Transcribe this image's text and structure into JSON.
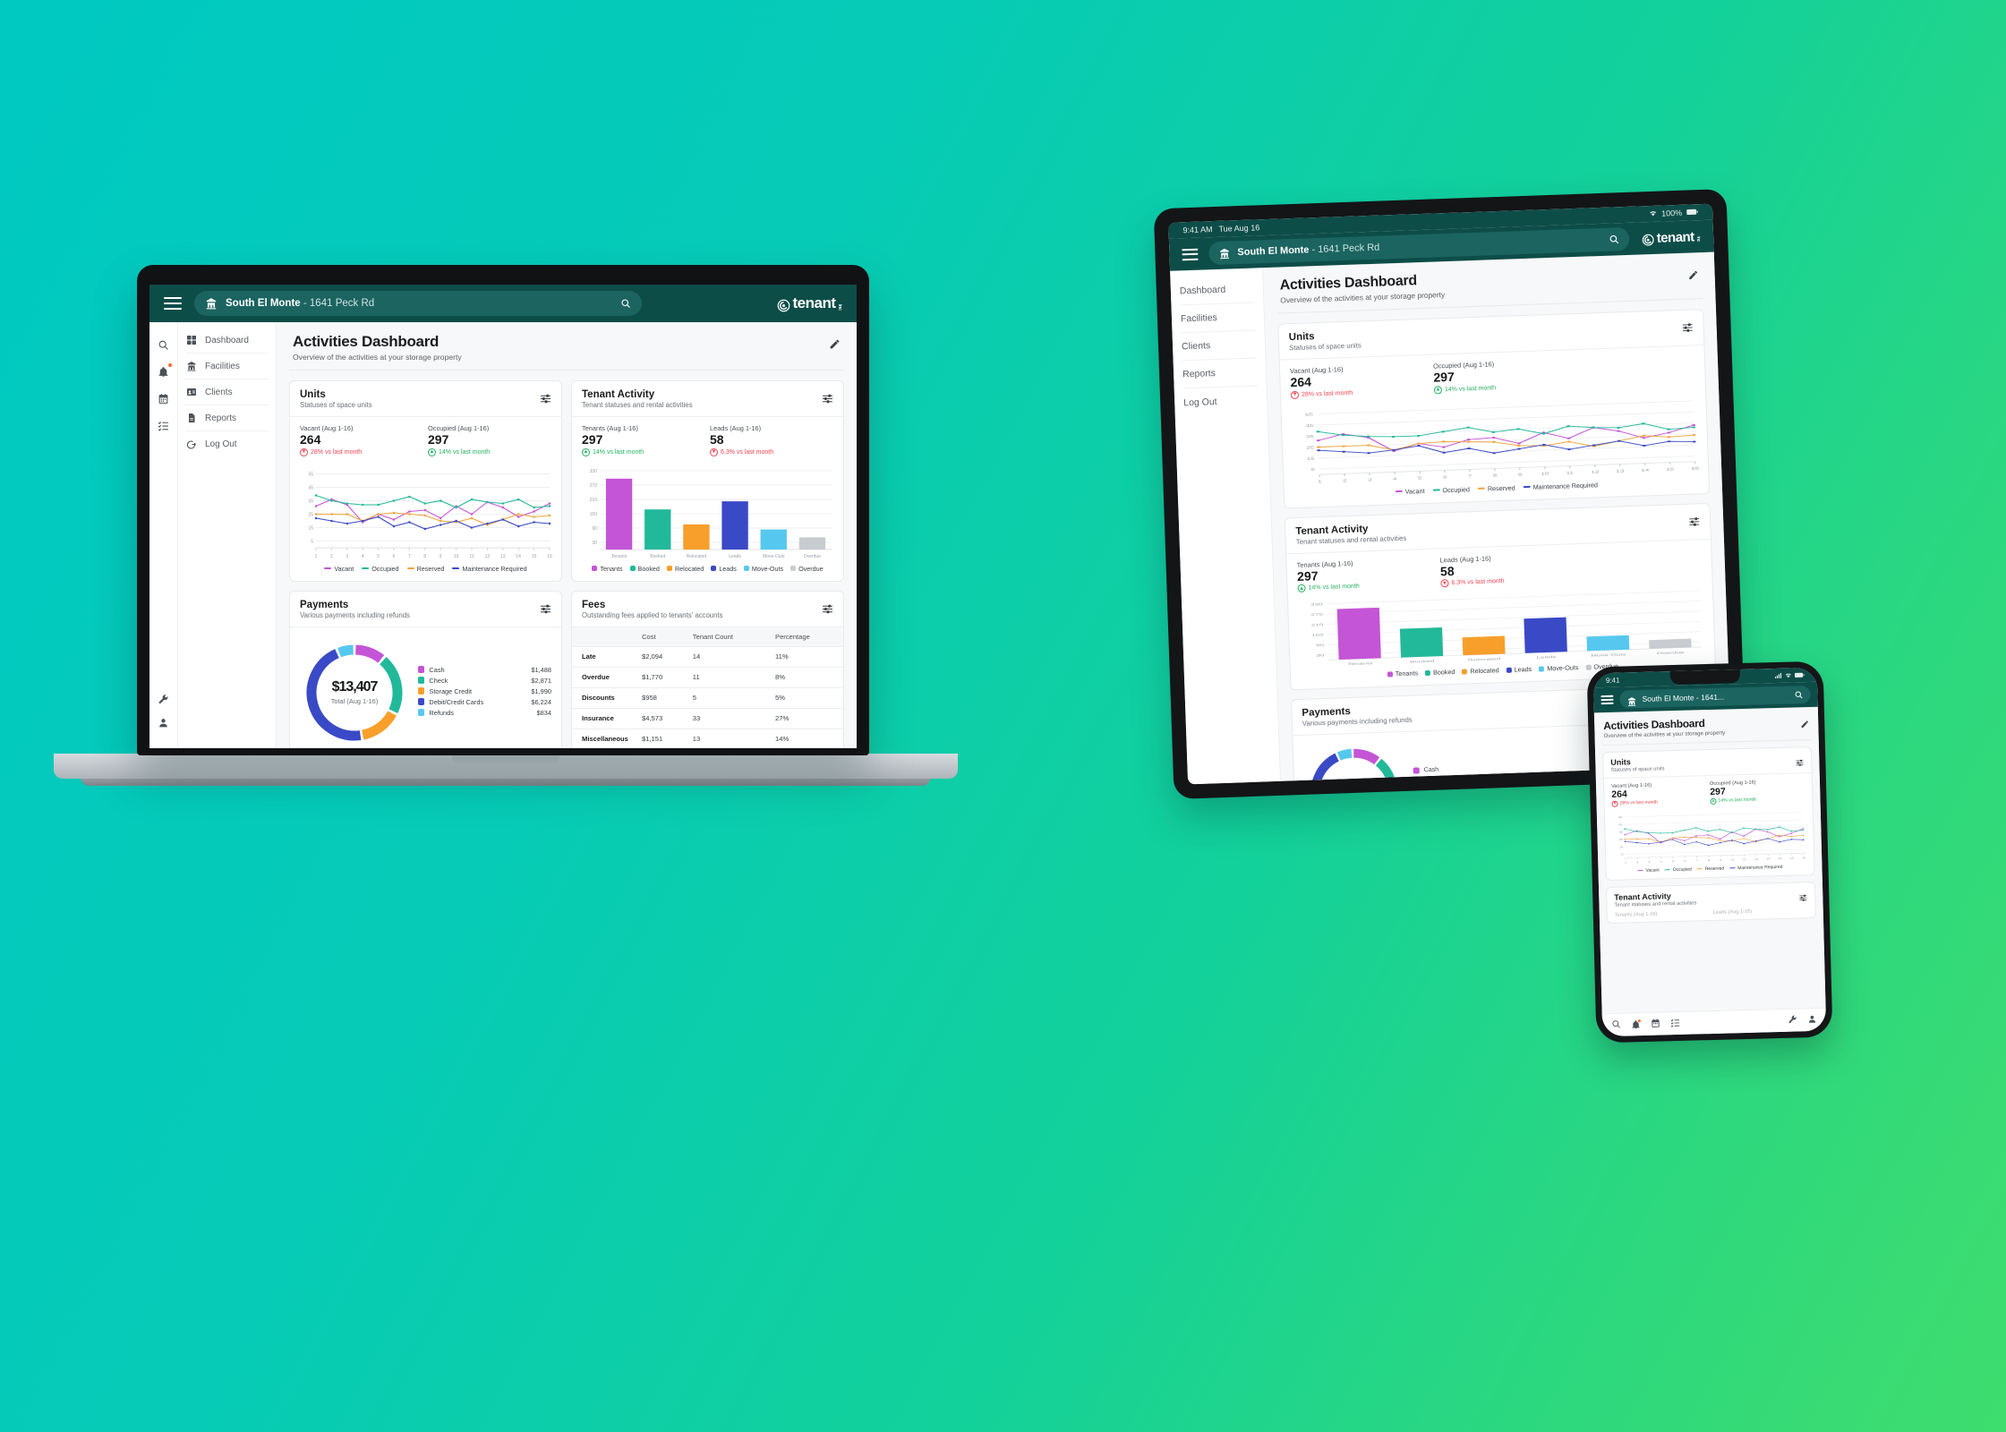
{
  "brand": {
    "logo_text": "tenant",
    "logo_suffix": "inc",
    "accent_teal": "#0d4d48",
    "pill_teal": "#1b6460",
    "bg_gradient_from": "#00c9c2",
    "bg_gradient_to": "#3fdd6e"
  },
  "topbar": {
    "property_name": "South El Monte",
    "property_address": "- 1641 Peck Rd",
    "property_full": "South El Monte - 1641 Peck Rd",
    "property_truncated": "South El Monte - 1641...",
    "menu_icon": "hamburger-icon",
    "search_icon": "search-icon",
    "house_icon": "storage-facility-icon"
  },
  "page": {
    "title": "Activities Dashboard",
    "subtitle": "Overview of the activities at your storage property",
    "edit_icon": "pencil-icon"
  },
  "sidebar": {
    "items": [
      {
        "label": "Dashboard",
        "icon": "grid-icon"
      },
      {
        "label": "Facilities",
        "icon": "storage-facility-icon"
      },
      {
        "label": "Clients",
        "icon": "id-card-icon"
      },
      {
        "label": "Reports",
        "icon": "document-icon"
      },
      {
        "label": "Log Out",
        "icon": "logout-icon"
      }
    ]
  },
  "icon_rail": {
    "top": [
      "search-icon",
      "notification-bell-icon",
      "calendar-icon",
      "checklist-icon"
    ],
    "bottom": [
      "wrench-icon",
      "user-icon"
    ]
  },
  "phone_tabbar": {
    "items": [
      "search-icon",
      "notification-bell-icon",
      "calendar-icon",
      "checklist-icon",
      "wrench-icon",
      "user-icon"
    ]
  },
  "tablet_status": {
    "time": "9:41 AM",
    "date": "Tue Aug 16",
    "battery": "100%",
    "wifi_icon": "wifi-icon",
    "battery_icon": "battery-icon"
  },
  "phone_status": {
    "time": "9:41",
    "signal_icon": "cellular-icon",
    "wifi_icon": "wifi-icon",
    "battery_icon": "battery-icon"
  },
  "cards": {
    "units": {
      "title": "Units",
      "subtitle": "Statuses of space units",
      "settings_icon": "sliders-icon",
      "kpis": [
        {
          "label": "Vacant (Aug 1-16)",
          "value": "264",
          "delta": "28% vs last month",
          "direction": "down"
        },
        {
          "label": "Occupied (Aug 1-16)",
          "value": "297",
          "delta": "14% vs last month",
          "direction": "up"
        }
      ]
    },
    "tenant_activity": {
      "title": "Tenant Activity",
      "subtitle": "Tenant statuses and rental activities",
      "settings_icon": "sliders-icon",
      "kpis": [
        {
          "label": "Tenants (Aug 1-16)",
          "value": "297",
          "delta": "14% vs last month",
          "direction": "up"
        },
        {
          "label": "Leads (Aug 1-16)",
          "value": "58",
          "delta": "6.3% vs last month",
          "direction": "down"
        }
      ]
    },
    "payments": {
      "title": "Payments",
      "subtitle": "Various payments including refunds",
      "settings_icon": "sliders-icon",
      "total": "$13,407",
      "total_label": "Total (Aug 1-16)"
    },
    "fees": {
      "title": "Fees",
      "subtitle": "Outstanding fees applied to tenants' accounts",
      "settings_icon": "sliders-icon"
    }
  },
  "chart_data": [
    {
      "type": "line",
      "id": "units-line-chart",
      "title": "Units",
      "xlabel": "",
      "ylabel": "",
      "x": [
        1,
        2,
        3,
        4,
        5,
        6,
        7,
        8,
        9,
        10,
        11,
        12,
        13,
        14,
        15,
        16
      ],
      "ytick_labels": [
        "55",
        "45",
        "35",
        "25",
        "15",
        "5"
      ],
      "ylim": [
        0,
        60
      ],
      "grid": true,
      "legend_position": "bottom",
      "series": [
        {
          "name": "Vacant",
          "color": "#c455d6",
          "values": [
            31,
            36,
            32,
            19,
            25,
            21,
            27,
            28,
            22,
            31,
            25,
            34,
            30,
            23,
            27,
            33
          ]
        },
        {
          "name": "Occupied",
          "color": "#22b99a",
          "values": [
            39,
            35,
            33,
            32,
            32,
            35,
            38,
            33,
            35,
            30,
            36,
            34,
            33,
            36,
            30,
            31
          ]
        },
        {
          "name": "Reserved",
          "color": "#f0a53a",
          "values": [
            25,
            25,
            25,
            20,
            25,
            26,
            25,
            24,
            20,
            19,
            22,
            17,
            21,
            25,
            23,
            24
          ]
        },
        {
          "name": "Maintenance Required",
          "color": "#3a49c6",
          "values": [
            22,
            20,
            18,
            20,
            23,
            16,
            19,
            14,
            17,
            20,
            15,
            18,
            21,
            16,
            19,
            18
          ]
        }
      ]
    },
    {
      "type": "bar",
      "id": "tenant-activity-bar-chart",
      "title": "Tenant Activity",
      "categories": [
        "Tenants",
        "Booked",
        "Relocated",
        "Leads",
        "Move-Outs",
        "Overdue"
      ],
      "values": [
        297,
        168,
        105,
        202,
        84,
        51
      ],
      "colors": [
        "#c455d6",
        "#22b99a",
        "#f79f2a",
        "#3a49c6",
        "#56c8f0",
        "#c8ccd0"
      ],
      "ytick_labels": [
        "330",
        "270",
        "210",
        "150",
        "90",
        "30"
      ],
      "ylim": [
        0,
        330
      ],
      "grid": true,
      "legend_position": "bottom",
      "legend": [
        "Tenants",
        "Booked",
        "Relocated",
        "Leads",
        "Move-Outs",
        "Overdue"
      ]
    },
    {
      "type": "pie",
      "id": "payments-donut-chart",
      "title": "Payments",
      "center_label": "$13,407",
      "center_sublabel": "Total (Aug 1-16)",
      "labels": [
        "Cash",
        "Check",
        "Storage Credit",
        "Debit/Credit Cards",
        "Refunds"
      ],
      "values": [
        1488,
        2871,
        1990,
        6224,
        834
      ],
      "value_labels": [
        "$1,488",
        "$2,871",
        "$1,990",
        "$6,224",
        "$834"
      ],
      "colors": [
        "#c455d6",
        "#22b99a",
        "#f79f2a",
        "#3a49c6",
        "#56c8f0"
      ]
    },
    {
      "type": "table",
      "id": "fees-table",
      "title": "Fees",
      "columns": [
        "",
        "Cost",
        "Tenant Count",
        "Percentage"
      ],
      "rows": [
        [
          "Late",
          "$2,094",
          "14",
          "11%"
        ],
        [
          "Overdue",
          "$1,770",
          "11",
          "8%"
        ],
        [
          "Discounts",
          "$958",
          "5",
          "5%"
        ],
        [
          "Insurance",
          "$4,573",
          "33",
          "27%"
        ],
        [
          "Miscellaneous",
          "$1,151",
          "13",
          "14%"
        ]
      ]
    }
  ]
}
